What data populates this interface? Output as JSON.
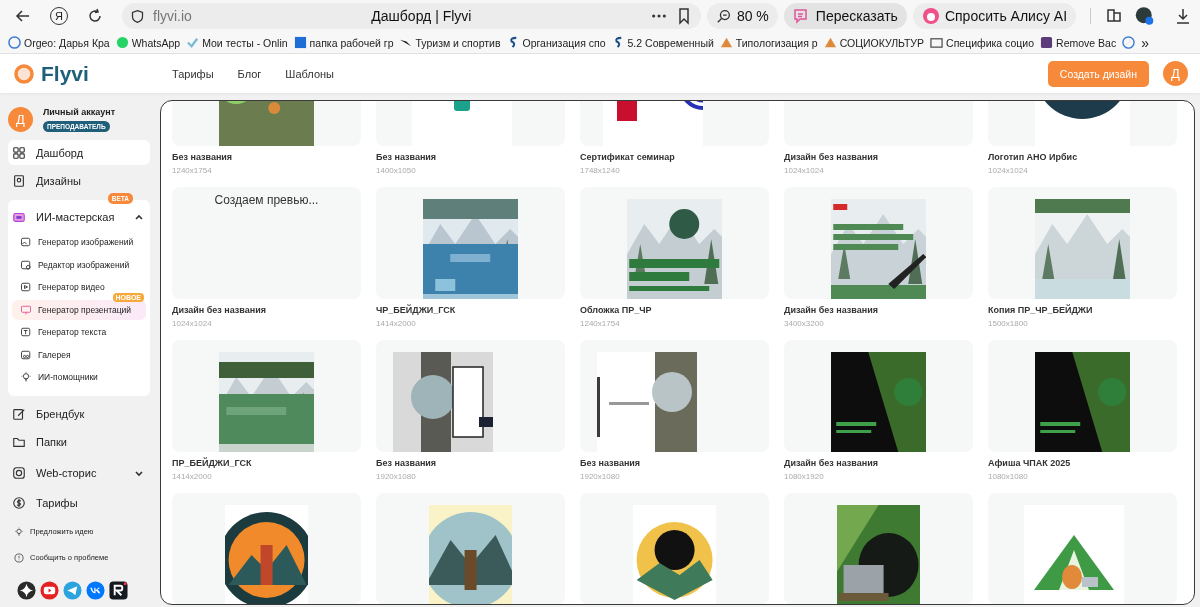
{
  "browser": {
    "home_glyph": "Я",
    "address": "flyvi.io",
    "title": "Дашборд | Flyvi",
    "zoom": "80 %",
    "retell": "Пересказать",
    "alice": "Спросить Алису AI",
    "more_glyph": "»"
  },
  "bookmarks": [
    {
      "label": "Orgeo: Дарья Кра"
    },
    {
      "label": "WhatsApp"
    },
    {
      "label": "Мои тесты - Onlin"
    },
    {
      "label": "папка рабочей гр"
    },
    {
      "label": "Туризм и спортив"
    },
    {
      "label": "Организация спо"
    },
    {
      "label": "5.2 Современный"
    },
    {
      "label": "Типологизация р"
    },
    {
      "label": "СОЦИОКУЛЬТУР"
    },
    {
      "label": "Специфика социо"
    },
    {
      "label": "Remove Bac"
    }
  ],
  "header": {
    "logo": "Flyvi",
    "nav": [
      {
        "label": "Тарифы"
      },
      {
        "label": "Блог"
      },
      {
        "label": "Шаблоны"
      }
    ],
    "create_button": "Создать дизайн",
    "avatar": "Д"
  },
  "account": {
    "avatar": "Д",
    "name": "Личный аккаунт",
    "role": "ПРЕПОДАВАТЕЛЬ"
  },
  "sidebar": {
    "items": [
      {
        "kind": "link",
        "label": "Дашборд",
        "selected": true
      },
      {
        "kind": "link",
        "label": "Дизайны",
        "selected": false
      },
      {
        "kind": "group",
        "label": "ИИ-мастерская",
        "badge": "BETA",
        "expanded": true,
        "children": [
          {
            "label": "Генератор изображений",
            "selected": false
          },
          {
            "label": "Редактор изображений",
            "selected": false
          },
          {
            "label": "Генератор видео",
            "selected": false
          },
          {
            "label": "Генератор презентаций",
            "badge": "НОВОЕ",
            "selected": true
          },
          {
            "label": "Генератор текста",
            "selected": false
          },
          {
            "label": "Галерея",
            "selected": false
          },
          {
            "label": "ИИ-помощники",
            "selected": false
          }
        ]
      },
      {
        "kind": "link",
        "label": "Брендбук",
        "selected": false
      },
      {
        "kind": "link",
        "label": "Папки",
        "selected": false
      },
      {
        "kind": "group",
        "label": "Web-сторис",
        "expanded": false
      },
      {
        "kind": "link",
        "label": "Тарифы",
        "selected": false
      }
    ],
    "footer": [
      {
        "label": "Предложить идею"
      },
      {
        "label": "Сообщить о проблеме"
      }
    ]
  },
  "designs": [
    {
      "title": "Без названия",
      "size": "1240x1754",
      "kind": "picture"
    },
    {
      "title": "Без названия",
      "size": "1400x1050",
      "kind": "picture"
    },
    {
      "title": "Сертификат семинар",
      "size": "1748x1240",
      "kind": "picture"
    },
    {
      "title": "Дизайн без названия",
      "size": "1024x1024",
      "kind": "empty"
    },
    {
      "title": "Логотип АНО Ирбис",
      "size": "1024x1024",
      "kind": "picture"
    },
    {
      "title": "Дизайн без названия",
      "size": "1024x1024",
      "kind": "pending",
      "status": "Создаем превью..."
    },
    {
      "title": "ЧР_БЕЙДЖИ_ГСК",
      "size": "1414x2000",
      "kind": "picture"
    },
    {
      "title": "Обложка ПР_ЧР",
      "size": "1240x1754",
      "kind": "picture"
    },
    {
      "title": "Дизайн без названия",
      "size": "3400x3200",
      "kind": "picture"
    },
    {
      "title": "Копия ПР_ЧР_БЕЙДЖИ",
      "size": "1500x1800",
      "kind": "picture"
    },
    {
      "title": "ПР_БЕЙДЖИ_ГСК",
      "size": "1414x2000",
      "kind": "picture"
    },
    {
      "title": "Без названия",
      "size": "1920x1080",
      "kind": "picture"
    },
    {
      "title": "Без названия",
      "size": "1920x1080",
      "kind": "picture"
    },
    {
      "title": "Дизайн без названия",
      "size": "1080x1920",
      "kind": "picture"
    },
    {
      "title": "Афиша ЧПАК 2025",
      "size": "1080x1080",
      "kind": "picture"
    },
    {
      "kind": "picture"
    },
    {
      "kind": "picture"
    },
    {
      "kind": "picture"
    },
    {
      "kind": "picture"
    },
    {
      "kind": "picture"
    }
  ]
}
